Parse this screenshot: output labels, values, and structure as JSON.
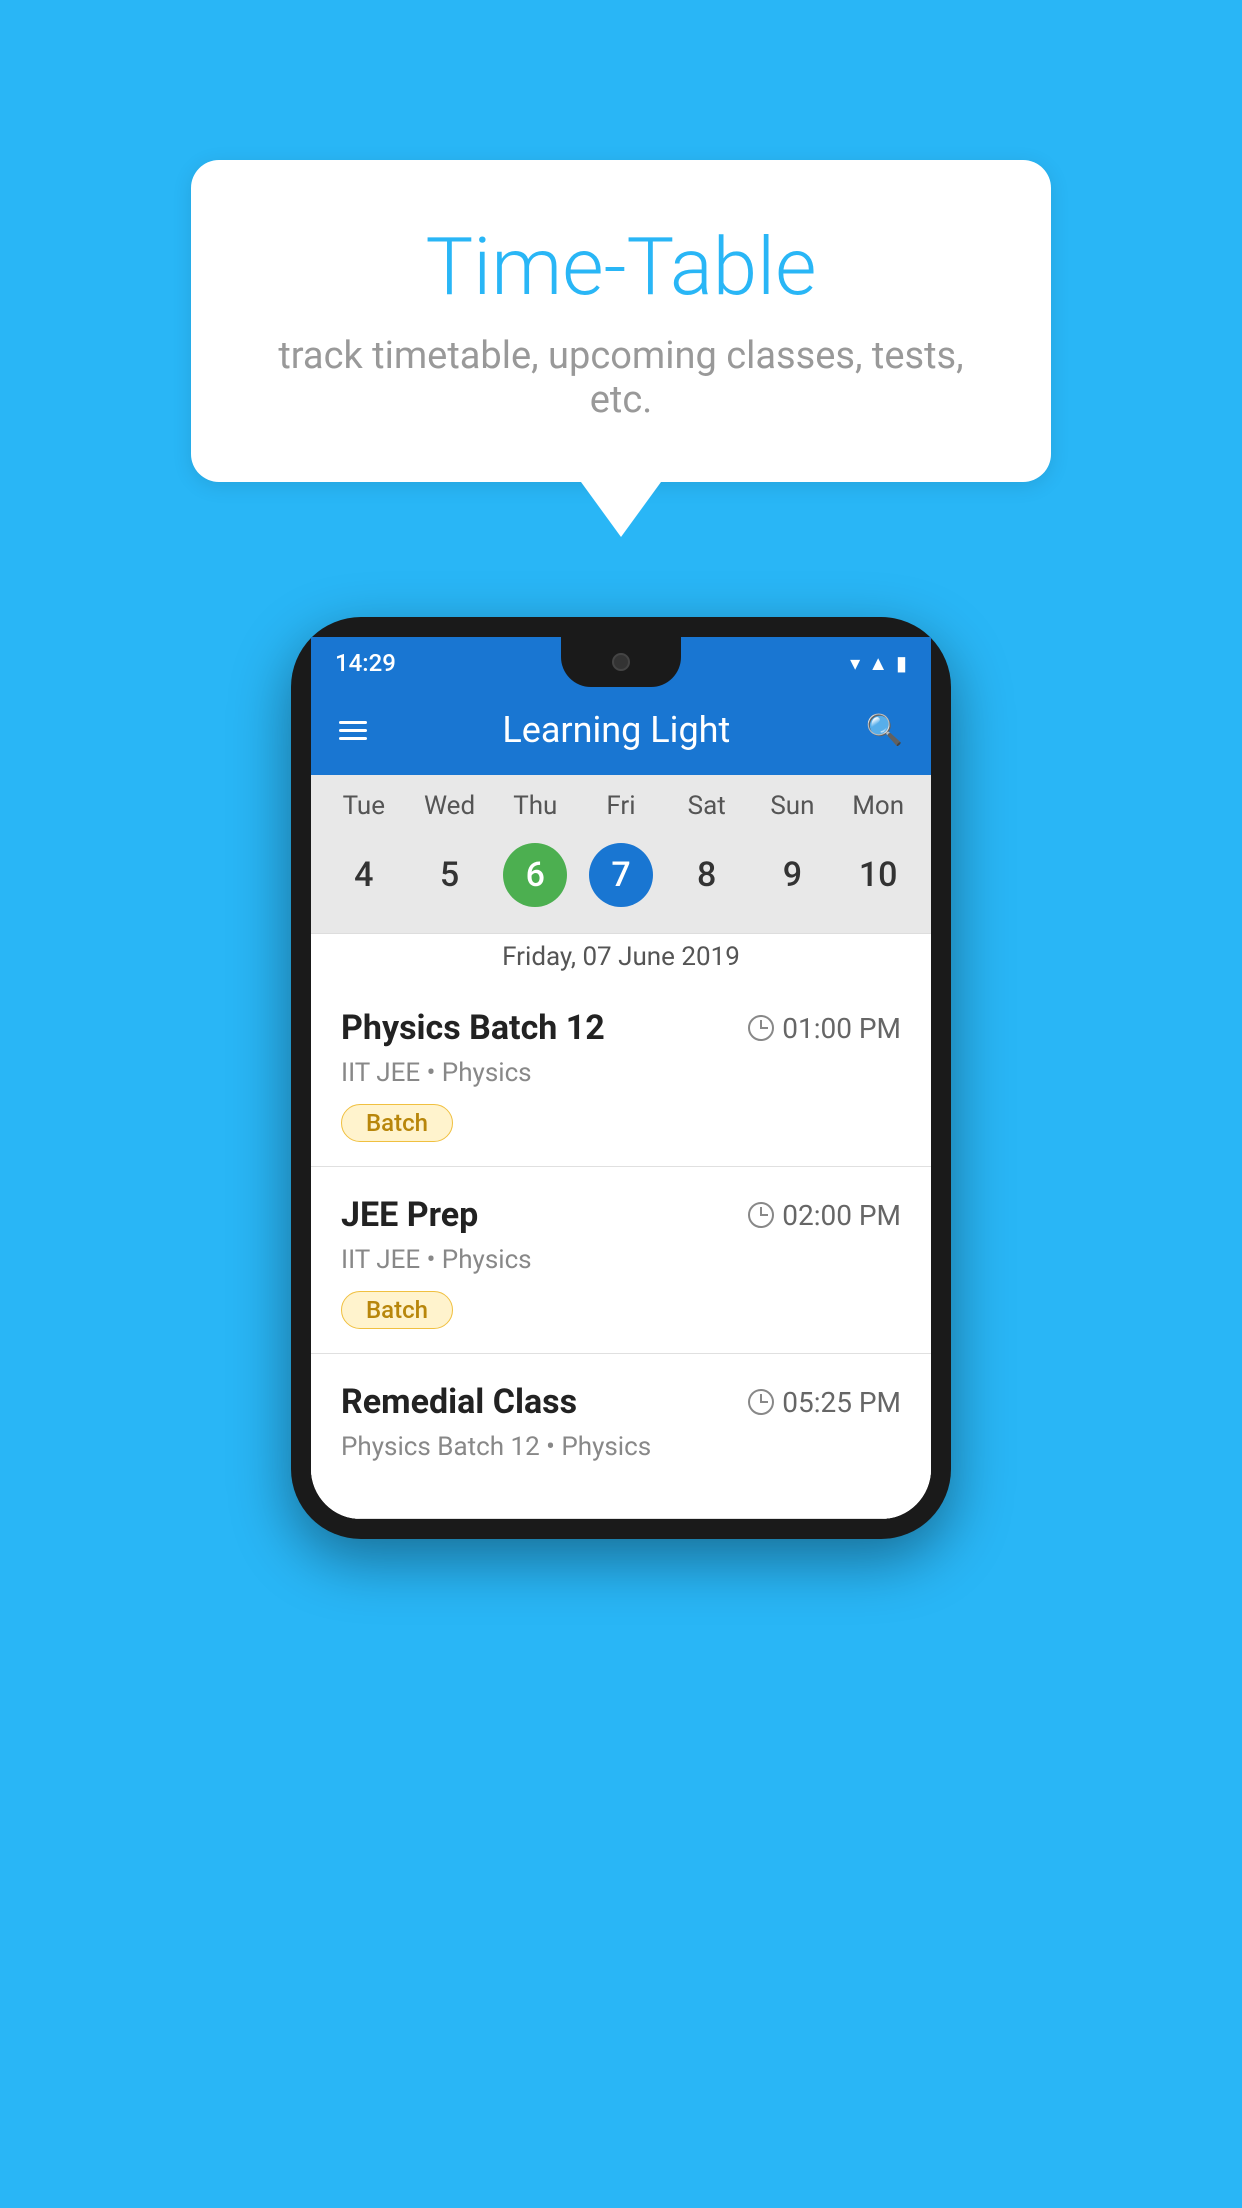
{
  "header": {
    "title": "Time-Table",
    "subtitle": "track timetable, upcoming classes, tests, etc."
  },
  "phone": {
    "statusBar": {
      "time": "14:29"
    },
    "appBar": {
      "title": "Learning Light"
    },
    "calendar": {
      "dayLabels": [
        "Tue",
        "Wed",
        "Thu",
        "Fri",
        "Sat",
        "Sun",
        "Mon"
      ],
      "dates": [
        "4",
        "5",
        "6",
        "7",
        "8",
        "9",
        "10"
      ],
      "todayIndex": 2,
      "selectedIndex": 3,
      "selectedDateLabel": "Friday, 07 June 2019"
    },
    "classes": [
      {
        "name": "Physics Batch 12",
        "time": "01:00 PM",
        "meta": "IIT JEE • Physics",
        "badge": "Batch"
      },
      {
        "name": "JEE Prep",
        "time": "02:00 PM",
        "meta": "IIT JEE • Physics",
        "badge": "Batch"
      },
      {
        "name": "Remedial Class",
        "time": "05:25 PM",
        "meta": "Physics Batch 12 • Physics",
        "badge": ""
      }
    ]
  }
}
